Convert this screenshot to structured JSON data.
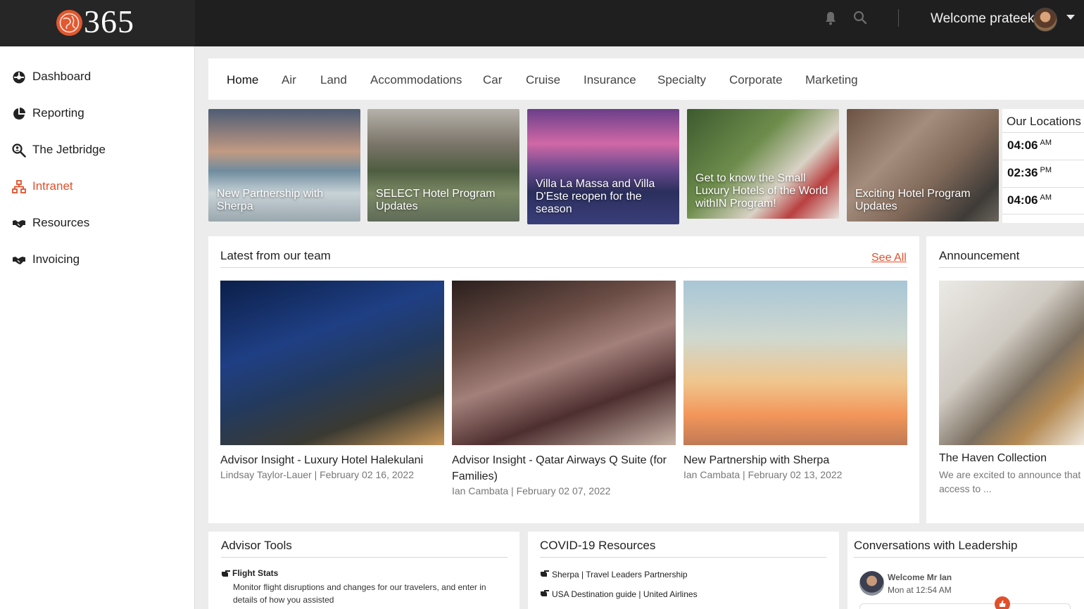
{
  "brand": {
    "logo_text": "365",
    "accent": "#e0502b"
  },
  "topbar": {
    "welcome": "Welcome prateek",
    "icons": [
      "bell-icon",
      "search-icon",
      "chevron-down-icon"
    ]
  },
  "sidebar": {
    "items": [
      {
        "label": "Dashboard",
        "icon": "dashboard-icon"
      },
      {
        "label": "Reporting",
        "icon": "pie-chart-icon"
      },
      {
        "label": "The Jetbridge",
        "icon": "search-people-icon"
      },
      {
        "label": "Intranet",
        "icon": "network-icon",
        "active": true
      },
      {
        "label": "Resources",
        "icon": "handshake-icon"
      },
      {
        "label": "Invoicing",
        "icon": "handshake-icon"
      }
    ]
  },
  "tabs": [
    "Home",
    "Air",
    "Land",
    "Accommodations",
    "Car",
    "Cruise",
    "Insurance",
    "Specialty",
    "Corporate",
    "Marketing"
  ],
  "features": [
    "New Partnership with Sherpa",
    "SELECT Hotel Program Updates",
    "Villa La Massa and Villa D'Este reopen for the season",
    "Get to know the Small Luxury Hotels of the World withIN Program!",
    "Exciting Hotel Program Updates"
  ],
  "locations": {
    "title": "Our Locations",
    "times": [
      {
        "time": "04:06",
        "ampm": "AM"
      },
      {
        "time": "02:36",
        "ampm": "PM"
      },
      {
        "time": "04:06",
        "ampm": "AM"
      }
    ]
  },
  "latest": {
    "title": "Latest from our team",
    "see_all": "See All",
    "cards": [
      {
        "title": "Advisor Insight - Luxury Hotel Halekulani",
        "meta": "Lindsay Taylor-Lauer | February 02 16, 2022"
      },
      {
        "title": "Advisor Insight - Qatar Airways Q Suite (for Families)",
        "meta": "Ian Cambata | February 02 07, 2022"
      },
      {
        "title": "New Partnership with Sherpa",
        "meta": "Ian Cambata | February 02 13, 2022"
      }
    ]
  },
  "announcement": {
    "title": "Announcement",
    "item_title": "The Haven Collection",
    "item_text": "We are excited to announce that access to ..."
  },
  "advisor_tools": {
    "title": "Advisor Tools",
    "tool_title": "Flight Stats",
    "tool_desc": "Monitor flight disruptions and changes for our travelers, and enter in details of how you assisted"
  },
  "covid": {
    "title": "COVID-19 Resources",
    "links": [
      "Sherpa | Travel Leaders Partnership",
      "USA Destination guide | United Airlines"
    ]
  },
  "leadership": {
    "title": "Conversations with Leadership",
    "name": "Welcome Mr Ian",
    "time": "Mon at 12:54 AM"
  }
}
